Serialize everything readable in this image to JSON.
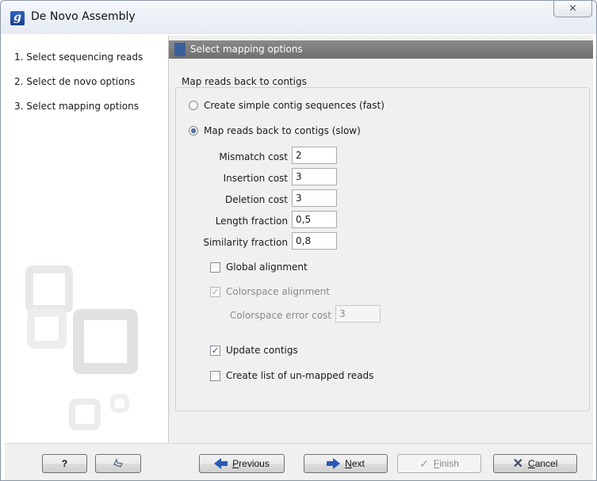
{
  "window": {
    "title": "De Novo Assembly",
    "app_icon_letter": "g",
    "close_symbol": "⨯"
  },
  "steps": [
    {
      "number": "1.",
      "label": "Select sequencing reads"
    },
    {
      "number": "2.",
      "label": "Select de novo options"
    },
    {
      "number": "3.",
      "label": "Select mapping options"
    }
  ],
  "panel": {
    "header": "Select mapping options",
    "group_label": "Map reads back to contigs",
    "radio_simple": {
      "label": "Create simple contig sequences (fast)",
      "selected": false
    },
    "radio_map": {
      "label": "Map reads back to contigs (slow)",
      "selected": true
    },
    "fields": [
      {
        "label": "Mismatch cost",
        "value": "2"
      },
      {
        "label": "Insertion cost",
        "value": "3"
      },
      {
        "label": "Deletion cost",
        "value": "3"
      },
      {
        "label": "Length fraction",
        "value": "0,5"
      },
      {
        "label": "Similarity fraction",
        "value": "0,8"
      }
    ],
    "global_alignment": {
      "label": "Global alignment",
      "checked": false
    },
    "colorspace_alignment": {
      "label": "Colorspace alignment",
      "checked": true,
      "enabled": false
    },
    "colorspace_error_cost": {
      "label": "Colorspace error cost",
      "value": "3",
      "enabled": false
    },
    "update_contigs": {
      "label": "Update contigs",
      "checked": true
    },
    "unmapped_reads": {
      "label": "Create list of un-mapped reads",
      "checked": false
    }
  },
  "buttons": {
    "help": "?",
    "reset_icon": "reset-icon",
    "previous_prefix": "",
    "previous_u": "P",
    "previous_rest": "revious",
    "next_u": "N",
    "next_rest": "ext",
    "finish_u": "F",
    "finish_rest": "inish",
    "cancel_u": "C",
    "cancel_rest": "ancel"
  },
  "colors": {
    "accent": "#2a5bb3",
    "header_bg": "#7c7c7c",
    "checkmark": "#2b4d8a"
  }
}
